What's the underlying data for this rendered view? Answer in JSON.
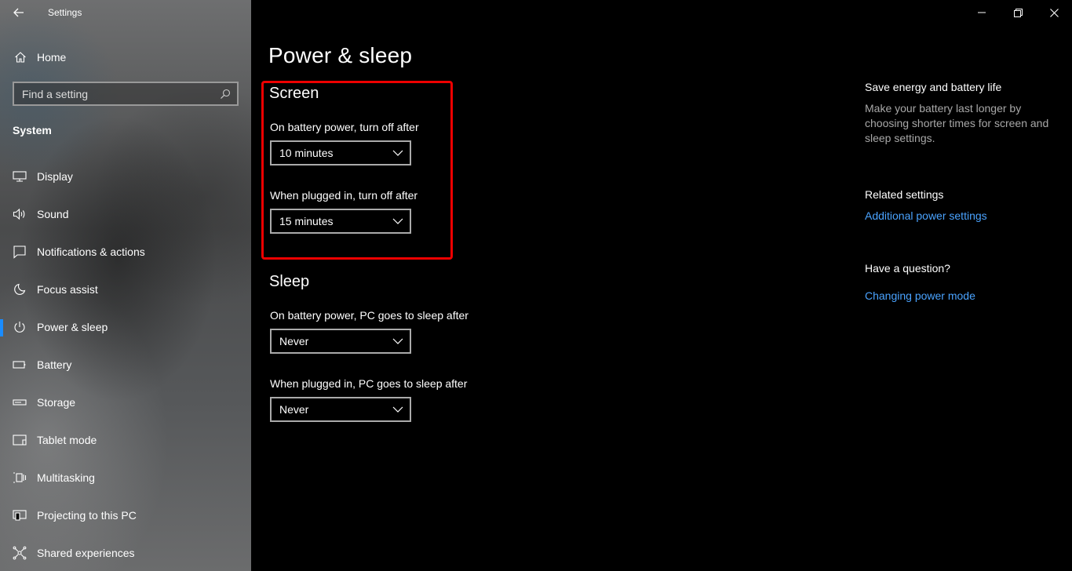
{
  "app": {
    "title": "Settings"
  },
  "sidebar": {
    "home_label": "Home",
    "search_placeholder": "Find a setting",
    "section": "System",
    "items": [
      {
        "label": "Display",
        "icon": "display-icon"
      },
      {
        "label": "Sound",
        "icon": "speaker-icon"
      },
      {
        "label": "Notifications & actions",
        "icon": "notification-icon"
      },
      {
        "label": "Focus assist",
        "icon": "moon-icon"
      },
      {
        "label": "Power & sleep",
        "icon": "power-icon",
        "active": true
      },
      {
        "label": "Battery",
        "icon": "battery-icon"
      },
      {
        "label": "Storage",
        "icon": "storage-icon"
      },
      {
        "label": "Tablet mode",
        "icon": "tablet-icon"
      },
      {
        "label": "Multitasking",
        "icon": "multitasking-icon"
      },
      {
        "label": "Projecting to this PC",
        "icon": "projecting-icon"
      },
      {
        "label": "Shared experiences",
        "icon": "shared-icon"
      }
    ]
  },
  "main": {
    "title": "Power & sleep",
    "screen": {
      "heading": "Screen",
      "battery_label": "On battery power, turn off after",
      "battery_value": "10 minutes",
      "plugged_label": "When plugged in, turn off after",
      "plugged_value": "15 minutes"
    },
    "sleep": {
      "heading": "Sleep",
      "battery_label": "On battery power, PC goes to sleep after",
      "battery_value": "Never",
      "plugged_label": "When plugged in, PC goes to sleep after",
      "plugged_value": "Never"
    }
  },
  "right": {
    "save_heading": "Save energy and battery life",
    "save_text": "Make your battery last longer by choosing shorter times for screen and sleep settings.",
    "related_heading": "Related settings",
    "related_link": "Additional power settings",
    "question_heading": "Have a question?",
    "question_link": "Changing power mode"
  },
  "colors": {
    "accent": "#1a8cff",
    "link": "#4aa3ff",
    "highlight": "#e00000"
  }
}
